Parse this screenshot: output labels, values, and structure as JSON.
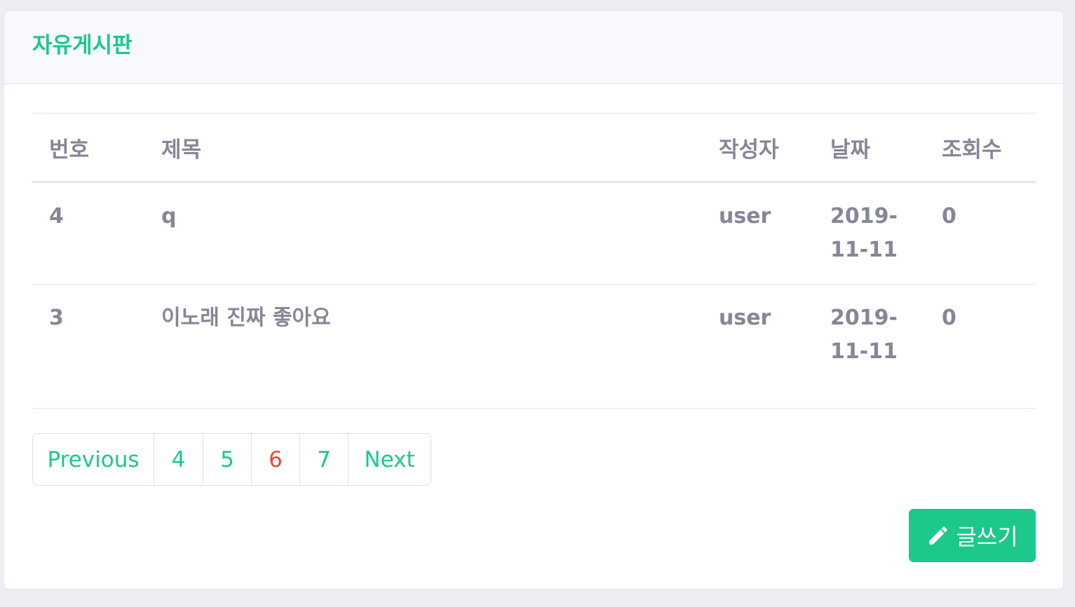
{
  "board": {
    "title": "자유게시판",
    "columns": [
      "번호",
      "제목",
      "작성자",
      "날짜",
      "조회수"
    ],
    "rows": [
      {
        "no": "4",
        "title": "q",
        "author": "user",
        "date": "2019-11-11",
        "views": "0"
      },
      {
        "no": "3",
        "title": "이노래 진짜 좋아요",
        "author": "user",
        "date": "2019-11-11",
        "views": "0"
      }
    ]
  },
  "pagination": {
    "items": [
      "Previous",
      "4",
      "5",
      "6",
      "7",
      "Next"
    ],
    "current": "6"
  },
  "actions": {
    "write_label": "글쓰기",
    "write_icon": "pencil-icon"
  },
  "colors": {
    "accent": "#1cc88a",
    "current_page": "#e74a3b",
    "text": "#858796"
  }
}
